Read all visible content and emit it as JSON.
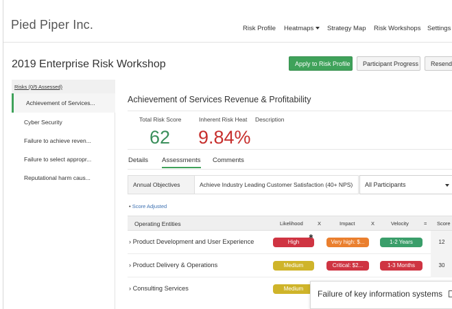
{
  "header": {
    "brand": "Pied Piper Inc.",
    "nav": [
      "Risk Profile",
      "Heatmaps",
      "Strategy Map",
      "Risk Workshops",
      "Settings"
    ]
  },
  "page": {
    "title": "2019 Enterprise Risk Workshop",
    "buttons": {
      "apply": "Apply to Risk Profile",
      "progress": "Participant Progress",
      "resend": "Resend"
    }
  },
  "sidebar": {
    "header": "Risks (0/5 Assessed)",
    "items": [
      "Achievement of Services...",
      "Cyber Security",
      "Failure to achieve reven...",
      "Failure to select appropr...",
      "Reputational harm caus..."
    ]
  },
  "risk": {
    "title": "Achievement of Services Revenue & Profitability",
    "total_label": "Total Risk Score",
    "total_value": "62",
    "heat_label": "Inherent Risk Heat",
    "heat_value": "9.84%",
    "desc_label": "Description"
  },
  "tabs": [
    "Details",
    "Assessments",
    "Comments"
  ],
  "filters": {
    "objective_label": "Annual Objectives",
    "objective_value": "Achieve Industry Leading Customer Satisfaction (40+ NPS)",
    "participants": "All Participants"
  },
  "note": "Score Adjusted",
  "table": {
    "headers": {
      "entities": "Operating Entities",
      "likelihood": "Likelihood",
      "x1": "X",
      "impact": "Impact",
      "x2": "X",
      "velocity": "Velocity",
      "eq": "=",
      "score": "Score"
    },
    "rows": [
      {
        "entity": "Product Development and User Experience",
        "likelihood": "High",
        "impact": "Very high: $...",
        "velocity": "1-2 Years",
        "score": "12"
      },
      {
        "entity": "Product Delivery & Operations",
        "likelihood": "Medium",
        "impact": "Critical: $2...",
        "velocity": "1-3 Months",
        "score": "30"
      },
      {
        "entity": "Consulting Services",
        "likelihood": "Medium"
      }
    ]
  },
  "popover": {
    "title": "Failure of key information systems"
  },
  "colors": {
    "accent": "#3fa25a",
    "score_green": "#3a8f5b",
    "heat_red": "#c7302e",
    "high": "#cf3442",
    "very_high": "#ea7f2e",
    "medium": "#cfb42a",
    "velocity": "#3a9e6a"
  }
}
